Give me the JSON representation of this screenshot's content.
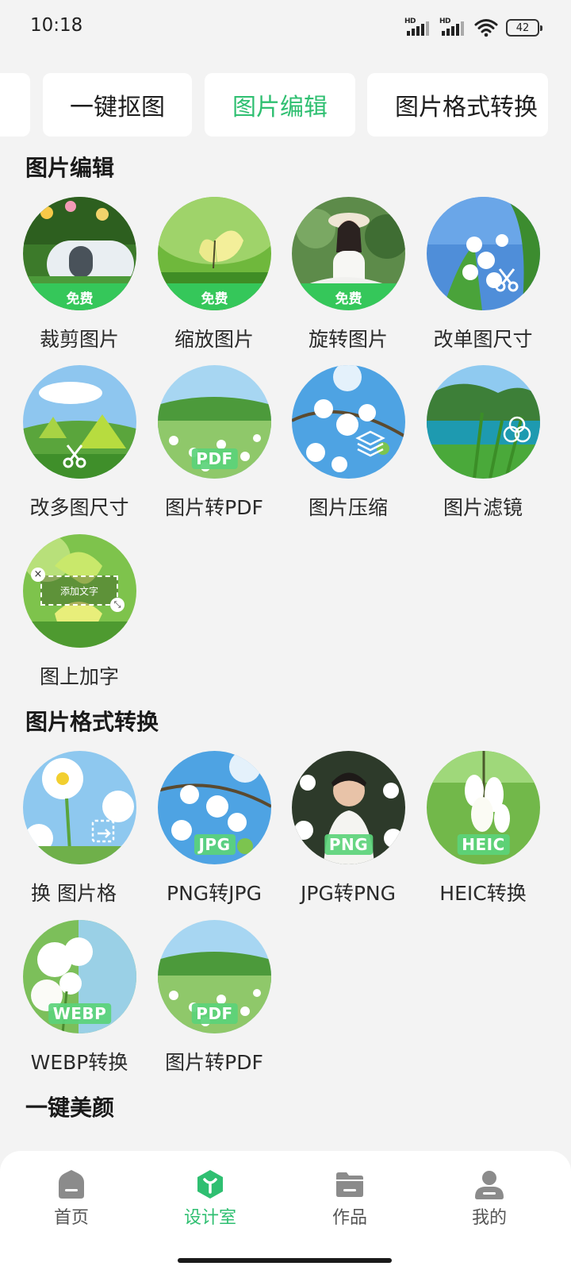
{
  "status_bar": {
    "time": "10:18",
    "signal1_label": "HD",
    "signal2_label": "HD",
    "battery": "42"
  },
  "tabs": [
    {
      "label": "一键抠图",
      "active": false
    },
    {
      "label": "图片编辑",
      "active": true
    },
    {
      "label": "图片格式转换",
      "active": false
    }
  ],
  "sections": {
    "edit": {
      "title": "图片编辑",
      "items": [
        {
          "label": "裁剪图片",
          "badge": "免费"
        },
        {
          "label": "缩放图片",
          "badge": "免费"
        },
        {
          "label": "旋转图片",
          "badge": "免费"
        },
        {
          "label": "改单图尺寸"
        },
        {
          "label": "改多图尺寸"
        },
        {
          "label": "图片转PDF",
          "format_badge": "PDF"
        },
        {
          "label": "图片压缩"
        },
        {
          "label": "图片滤镜"
        },
        {
          "label": "图上加字",
          "overlay_text": "添加文字"
        }
      ]
    },
    "convert": {
      "title": "图片格式转换",
      "items": [
        {
          "label": "换 图片格"
        },
        {
          "label": "PNG转JPG",
          "format_badge": "JPG"
        },
        {
          "label": "JPG转PNG",
          "format_badge": "PNG"
        },
        {
          "label": "HEIC转换",
          "format_badge": "HEIC"
        },
        {
          "label": "WEBP转换",
          "format_badge": "WEBP"
        },
        {
          "label": "图片转PDF",
          "format_badge": "PDF"
        }
      ]
    },
    "beauty": {
      "title": "一键美颜"
    }
  },
  "bottom_nav": [
    {
      "label": "首页",
      "icon": "home-icon",
      "active": false
    },
    {
      "label": "设计室",
      "icon": "design-studio-icon",
      "active": true
    },
    {
      "label": "作品",
      "icon": "folder-icon",
      "active": false
    },
    {
      "label": "我的",
      "icon": "profile-icon",
      "active": false
    }
  ],
  "colors": {
    "accent": "#2fbf71",
    "badge_green": "#35c75a",
    "background": "#f3f3f3"
  }
}
